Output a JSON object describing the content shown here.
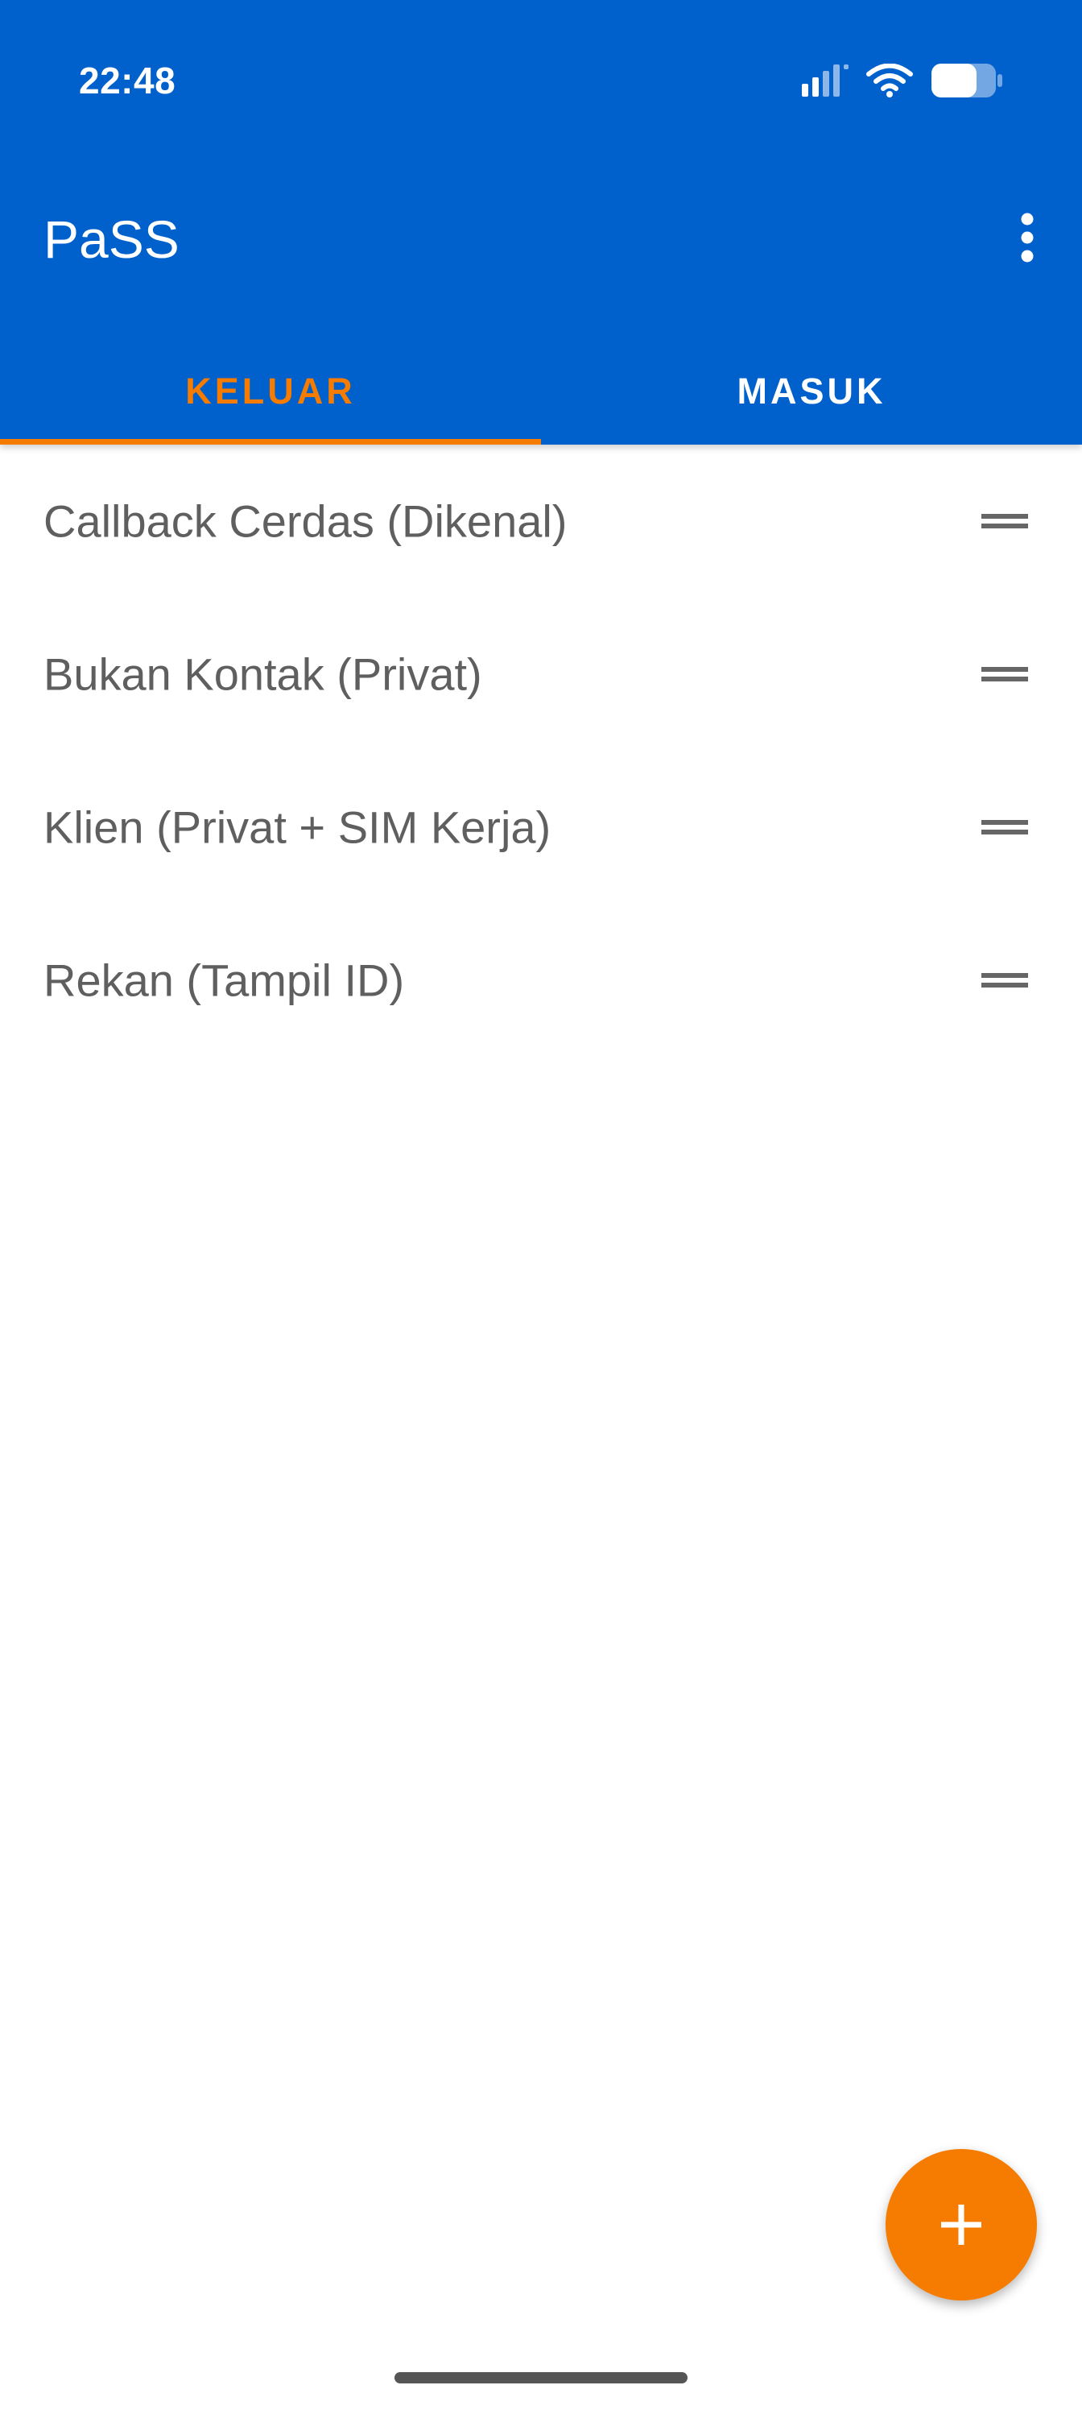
{
  "status_bar": {
    "time": "22:48",
    "icons": [
      "signal-icon",
      "wifi-icon",
      "battery-icon"
    ]
  },
  "toolbar": {
    "title": "PaSS",
    "overflow_icon": "more-vert-icon"
  },
  "tabs": [
    {
      "label": "KELUAR",
      "active": true
    },
    {
      "label": "MASUK",
      "active": false
    }
  ],
  "list": {
    "items": [
      {
        "label": "Callback Cerdas (Dikenal)"
      },
      {
        "label": "Bukan Kontak (Privat)"
      },
      {
        "label": "Klien (Privat + SIM Kerja)"
      },
      {
        "label": "Rekan (Tampil ID)"
      }
    ],
    "handle_icon": "drag-handle-icon"
  },
  "fab": {
    "icon": "add-icon"
  },
  "colors": {
    "primary": "#0060CC",
    "accent": "#F57C00",
    "text": "#5f5f5f",
    "background": "#FFFFFF"
  }
}
